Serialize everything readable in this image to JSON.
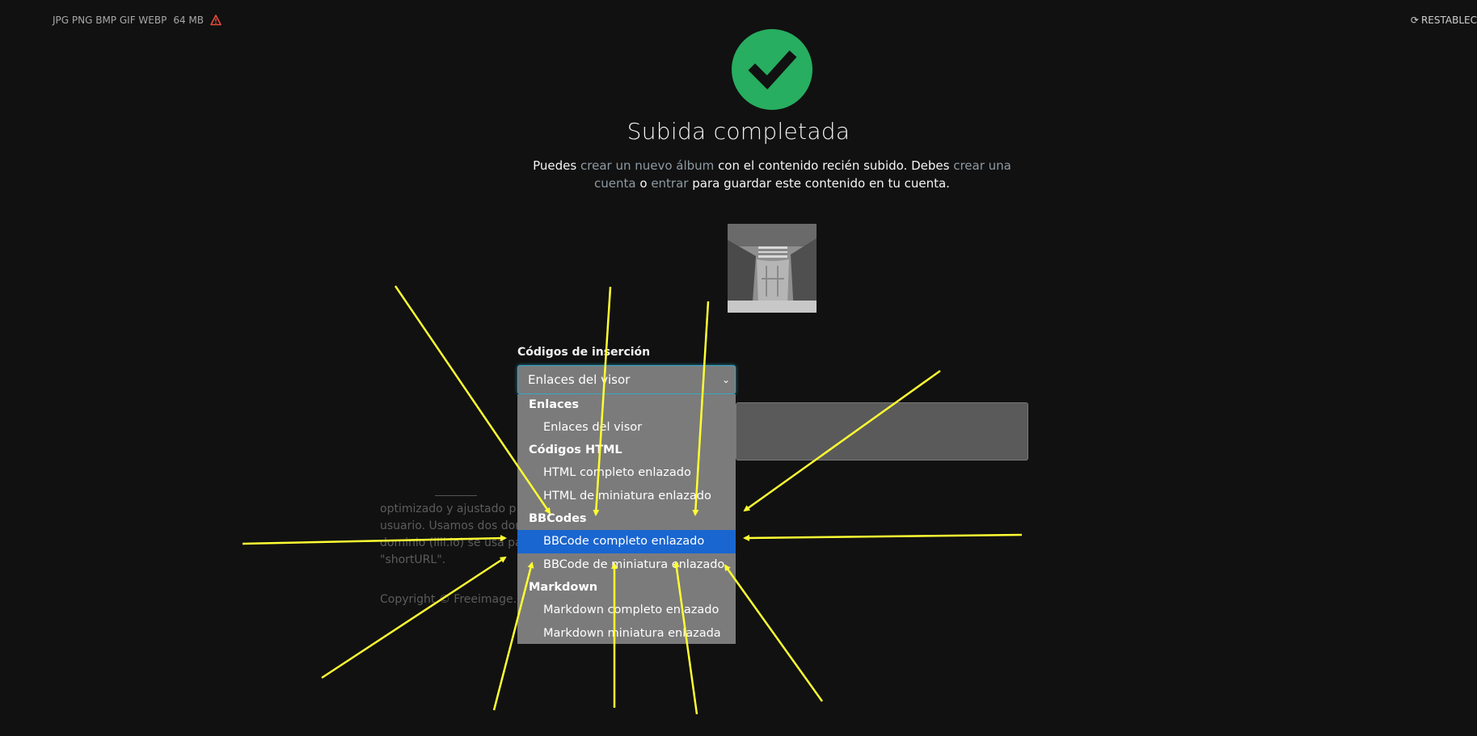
{
  "topbar": {
    "formats": "JPG PNG BMP GIF WEBP",
    "max_size": "64 MB",
    "reset_label": "RESTABLEC"
  },
  "upload": {
    "title": "Subida completada",
    "desc_part1": "Puedes ",
    "create_album_link": "crear un nuevo álbum",
    "desc_part2": " con el contenido recién subido. Debes ",
    "create_account_link": "crear una cuenta",
    "desc_part3": " o ",
    "login_link": "entrar",
    "desc_part4": " para guardar este contenido en tu cuenta."
  },
  "embed": {
    "label": "Códigos de inserción",
    "selected": "Enlaces del visor",
    "groups": [
      {
        "label": "Enlaces",
        "options": [
          "Enlaces del visor"
        ]
      },
      {
        "label": "Códigos HTML",
        "options": [
          "HTML completo enlazado",
          "HTML de miniatura enlazado"
        ]
      },
      {
        "label": "BBCodes",
        "options": [
          "BBCode completo enlazado",
          "BBCode de miniatura enlazado"
        ]
      },
      {
        "label": "Markdown",
        "options": [
          "Markdown completo enlazado",
          "Markdown miniatura enlazada"
        ]
      }
    ],
    "highlighted": "BBCode completo enlazado"
  },
  "footer": {
    "line1": "optimizado y ajustado p",
    "line2": "usuario. Usamos dos dor",
    "line3": "dominio (iili.io) se usa pa",
    "line4": "\"shortURL\".",
    "copyright": "Copyright © Freeimage.h"
  },
  "colors": {
    "background": "#111111",
    "success": "#27ae60",
    "link": "#8e9aa3",
    "highlight": "#1a66d0",
    "dropdown": "#7b7b7b",
    "annotation_arrow": "#ffff33"
  },
  "icons": {
    "warning": "warning-triangle-icon",
    "reset": "refresh-icon",
    "success": "checkmark-icon",
    "select": "chevron-down-icon"
  }
}
